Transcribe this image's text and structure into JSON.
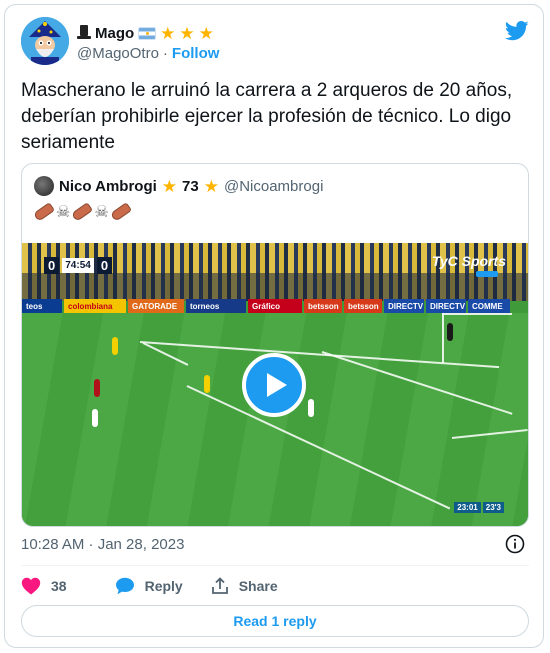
{
  "author": {
    "name": "Mago",
    "handle": "@MagoOtro",
    "follow_label": "Follow",
    "dot": "·"
  },
  "tweet": {
    "text": "Mascherano le arruinó la carrera a 2 arqueros de 20 años, deberían prohibirle ejercer la profesión de técnico. Lo digo seriamente"
  },
  "quote": {
    "name": "Nico Ambrogi",
    "number": "73",
    "handle": "@Nicoambrogi",
    "video": {
      "score_left": "0",
      "clock": "74:54",
      "score_right": "0",
      "broadcaster": "TyC Sports",
      "time_a": "23:01",
      "time_b": "23'3",
      "ads": [
        "teos",
        "colombiana",
        "GATORADE",
        "torneos",
        "Gráfico",
        "betsson",
        "betsson",
        "DIRECTV",
        "DIRECTV",
        "COMME"
      ]
    }
  },
  "meta": {
    "timestamp": "10:28 AM · Jan 28, 2023"
  },
  "actions": {
    "like_count": "38",
    "reply_label": "Reply",
    "share_label": "Share",
    "read_replies_label": "Read 1 reply"
  },
  "colors": {
    "accent": "#1d9bf0",
    "like": "#f91880",
    "star": "#ffb400"
  }
}
